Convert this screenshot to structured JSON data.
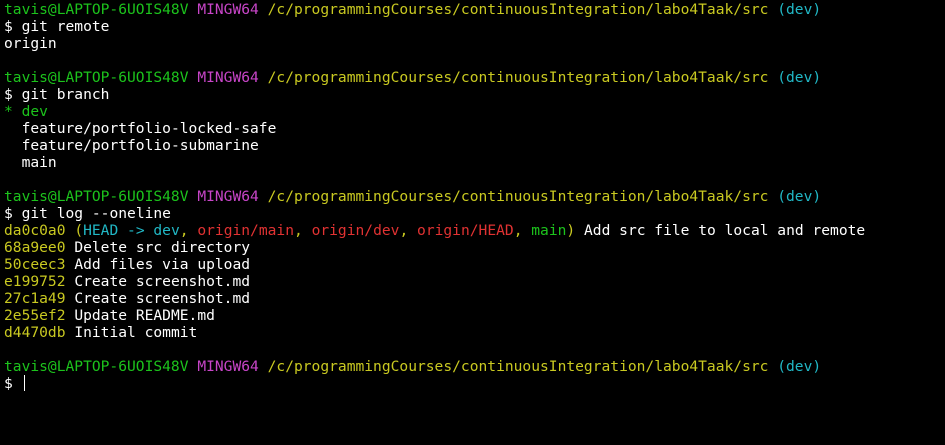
{
  "prompt": {
    "user_host": "tavis@LAPTOP-6UOIS48V",
    "shell": "MINGW64",
    "path": "/c/programmingCourses/continuousIntegration/labo4Taak/src",
    "branch": "(dev)",
    "symbol": "$"
  },
  "block1": {
    "command": "git remote",
    "output": [
      "origin"
    ]
  },
  "block2": {
    "command": "git branch",
    "current_marker": "*",
    "current_branch": "dev",
    "other_branches": [
      "feature/portfolio-locked-safe",
      "feature/portfolio-submarine",
      "main"
    ]
  },
  "block3": {
    "command": "git log --oneline",
    "head_commit": {
      "hash": "da0c0a0",
      "open": "(",
      "head": "HEAD -> dev",
      "sep": ", ",
      "origin_main": "origin/main",
      "origin_dev": "origin/dev",
      "origin_head": "origin/HEAD",
      "main": "main",
      "close": ")",
      "message": "Add src file to local and remote"
    },
    "commits": [
      {
        "hash": "68a9ee0",
        "message": "Delete src directory"
      },
      {
        "hash": "50ceec3",
        "message": "Add files via upload"
      },
      {
        "hash": "e199752",
        "message": "Create screenshot.md"
      },
      {
        "hash": "27c1a49",
        "message": "Create screenshot.md"
      },
      {
        "hash": "2e55ef2",
        "message": "Update README.md"
      },
      {
        "hash": "d4470db",
        "message": "Initial commit"
      }
    ]
  }
}
